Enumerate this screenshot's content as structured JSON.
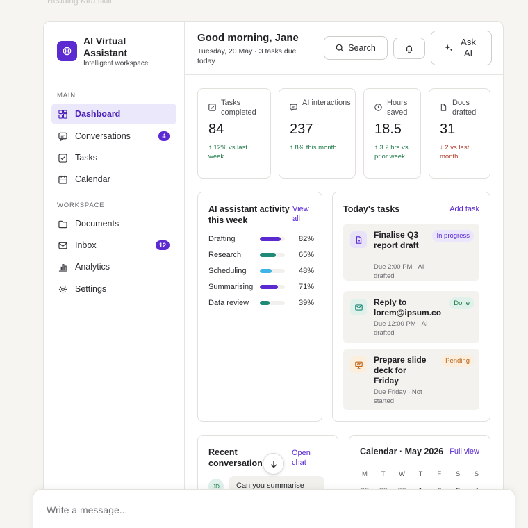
{
  "breadcrumb": "Reading Kira skill",
  "brand": {
    "title": "AI Virtual Assistant",
    "subtitle": "Intelligent workspace"
  },
  "sidebar": {
    "main_label": "MAIN",
    "workspace_label": "WORKSPACE",
    "main_items": [
      {
        "label": "Dashboard",
        "icon": "grid-icon",
        "active": true
      },
      {
        "label": "Conversations",
        "icon": "chat-icon",
        "badge": "4"
      },
      {
        "label": "Tasks",
        "icon": "checkbox-icon"
      },
      {
        "label": "Calendar",
        "icon": "calendar-icon"
      }
    ],
    "workspace_items": [
      {
        "label": "Documents",
        "icon": "folder-icon"
      },
      {
        "label": "Inbox",
        "icon": "mail-icon",
        "badge": "12"
      },
      {
        "label": "Analytics",
        "icon": "bar-chart-icon"
      },
      {
        "label": "Settings",
        "icon": "gear-icon"
      }
    ]
  },
  "header": {
    "greeting": "Good morning, Jane",
    "date": "Tuesday, 20 May · 3 tasks due today",
    "search_label": "Search",
    "ask_label": "Ask AI"
  },
  "stats": [
    {
      "label": "Tasks completed",
      "value": "84",
      "delta": "↑ 12% vs last week",
      "trend": "up",
      "icon": "checkbox-icon"
    },
    {
      "label": "AI interactions",
      "value": "237",
      "delta": "↑ 8% this month",
      "trend": "up",
      "icon": "chat-icon"
    },
    {
      "label": "Hours saved",
      "value": "18.5",
      "delta": "↑ 3.2 hrs vs prior week",
      "trend": "up",
      "icon": "clock-icon"
    },
    {
      "label": "Docs drafted",
      "value": "31",
      "delta": "↓ 2 vs last month",
      "trend": "down",
      "icon": "document-icon"
    }
  ],
  "activity": {
    "title": "AI assistant activity this week",
    "link": "View all",
    "rows": [
      {
        "label": "Drafting",
        "pct_text": "82%",
        "value": 0.82,
        "color": "#5b2ad0"
      },
      {
        "label": "Research",
        "pct_text": "65%",
        "value": 0.65,
        "color": "#1f8a78"
      },
      {
        "label": "Scheduling",
        "pct_text": "48%",
        "value": 0.48,
        "color": "#3fb4e6"
      },
      {
        "label": "Summarising",
        "pct_text": "71%",
        "value": 0.71,
        "color": "#5b2ad0"
      },
      {
        "label": "Data review",
        "pct_text": "39%",
        "value": 0.39,
        "color": "#1f8a78"
      }
    ]
  },
  "tasks": {
    "title": "Today's tasks",
    "link": "Add task",
    "items": [
      {
        "title": "Finalise Q3 report draft",
        "meta": "Due 2:00 PM · AI drafted",
        "status": "In progress",
        "icon": "document-icon"
      },
      {
        "title": "Reply to lorem@ipsum.co",
        "meta": "Due 12:00 PM · AI drafted",
        "status": "Done",
        "icon": "mail-icon"
      },
      {
        "title": "Prepare slide deck for Friday",
        "meta": "Due Friday · Not started",
        "status": "Pending",
        "icon": "presentation-icon"
      }
    ]
  },
  "recent": {
    "title": "Recent conversations",
    "link": "Open chat",
    "avatar": "JD",
    "preview": "Can you summarise"
  },
  "calendar": {
    "title": "Calendar · May 2026",
    "link": "Full view",
    "weekdays": [
      "M",
      "T",
      "W",
      "T",
      "F",
      "S",
      "S"
    ],
    "first_row": [
      "28",
      "29",
      "30",
      "1",
      "2",
      "3",
      "4"
    ]
  },
  "composer": {
    "placeholder": "Write a message..."
  },
  "colors": {
    "accent": "#5b2ad0",
    "positive": "#1f7a4a",
    "negative": "#b23b2a"
  }
}
